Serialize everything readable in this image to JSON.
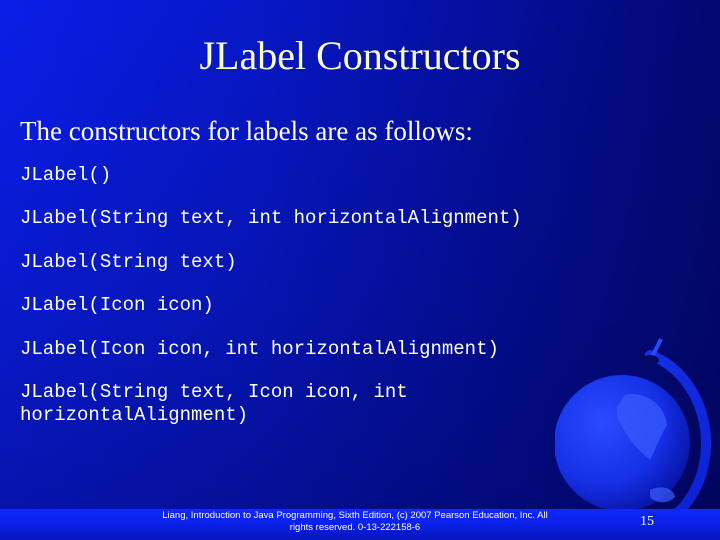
{
  "slide": {
    "title": "JLabel Constructors",
    "intro": "The constructors for labels are as follows:",
    "constructors": [
      "JLabel()",
      "JLabel(String text, int horizontalAlignment)",
      "JLabel(String text)",
      "JLabel(Icon icon)",
      "JLabel(Icon icon, int horizontalAlignment)",
      "JLabel(String text, Icon icon, int\nhorizontalAlignment)"
    ],
    "decoration_icon": "globe-icon"
  },
  "footer": {
    "citation_line1": "Liang, Introduction to Java Programming, Sixth Edition, (c) 2007 Pearson Education, Inc. All",
    "citation_line2": "rights reserved. 0-13-222158-6",
    "page_number": "15"
  },
  "colors": {
    "title": "#fbfbd0",
    "text": "#ffffff",
    "background_light": "#0a1ee8",
    "background_dark": "#020870"
  }
}
